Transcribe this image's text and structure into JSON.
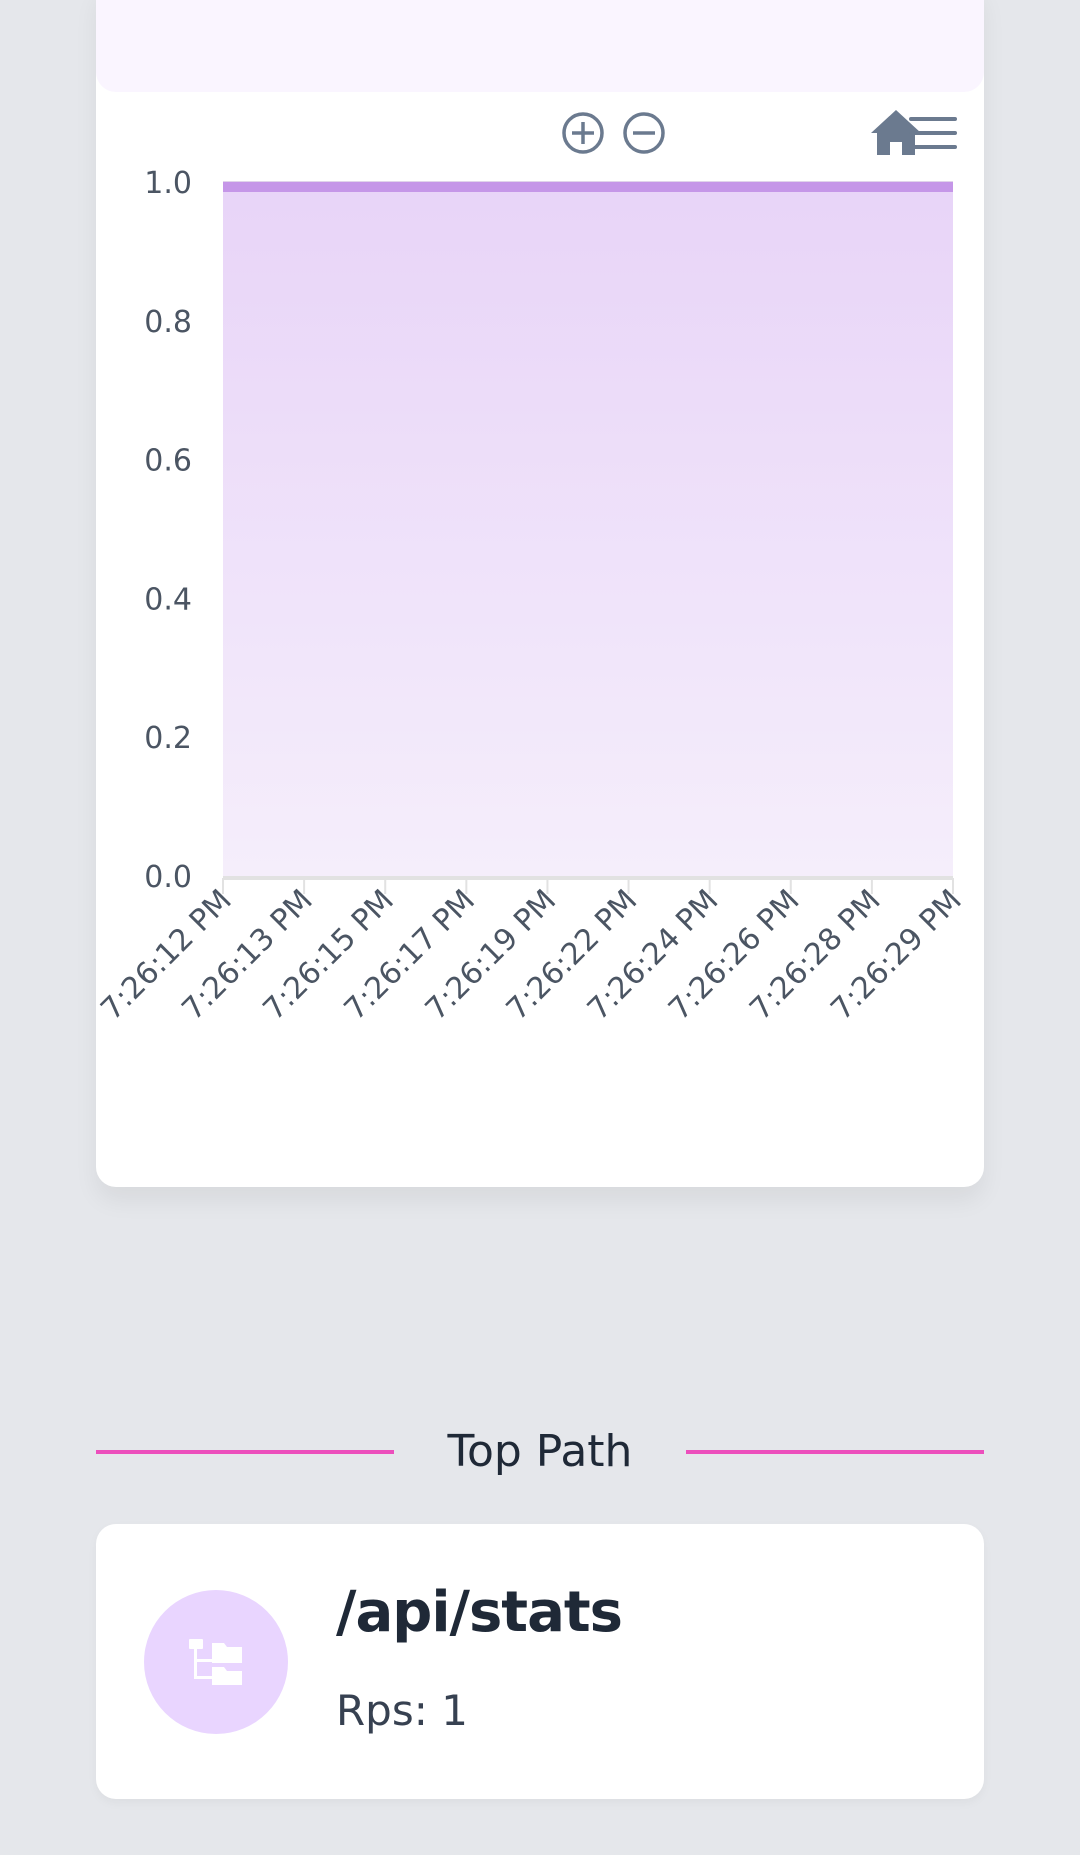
{
  "chart": {
    "toolbar": {
      "zoom_in": "zoom-in-icon",
      "zoom_out": "zoom-out-icon",
      "reset": "home-icon",
      "menu": "menu-icon"
    },
    "colors": {
      "area_top": "#e8d4f8",
      "area_bottom": "#f5eefb",
      "line": "#c596e8",
      "grid": "#e0d4ea",
      "axis_text": "#4b5563",
      "icon": "#6b7a8f"
    }
  },
  "chart_data": {
    "type": "area",
    "x": [
      "7:26:12 PM",
      "7:26:13 PM",
      "7:26:15 PM",
      "7:26:17 PM",
      "7:26:19 PM",
      "7:26:22 PM",
      "7:26:24 PM",
      "7:26:26 PM",
      "7:26:28 PM",
      "7:26:29 PM"
    ],
    "series": [
      {
        "values": [
          1,
          1,
          1,
          1,
          1,
          1,
          1,
          1,
          1,
          1
        ]
      }
    ],
    "yticks": [
      "0.0",
      "0.2",
      "0.4",
      "0.6",
      "0.8",
      "1.0"
    ],
    "ylim": [
      0,
      1
    ],
    "grid": true
  },
  "section": {
    "title": "Top Path",
    "accent": "#ec4fbc"
  },
  "top_path": {
    "icon": "folder-tree-icon",
    "path": "/api/stats",
    "rps": "Rps: 1"
  }
}
